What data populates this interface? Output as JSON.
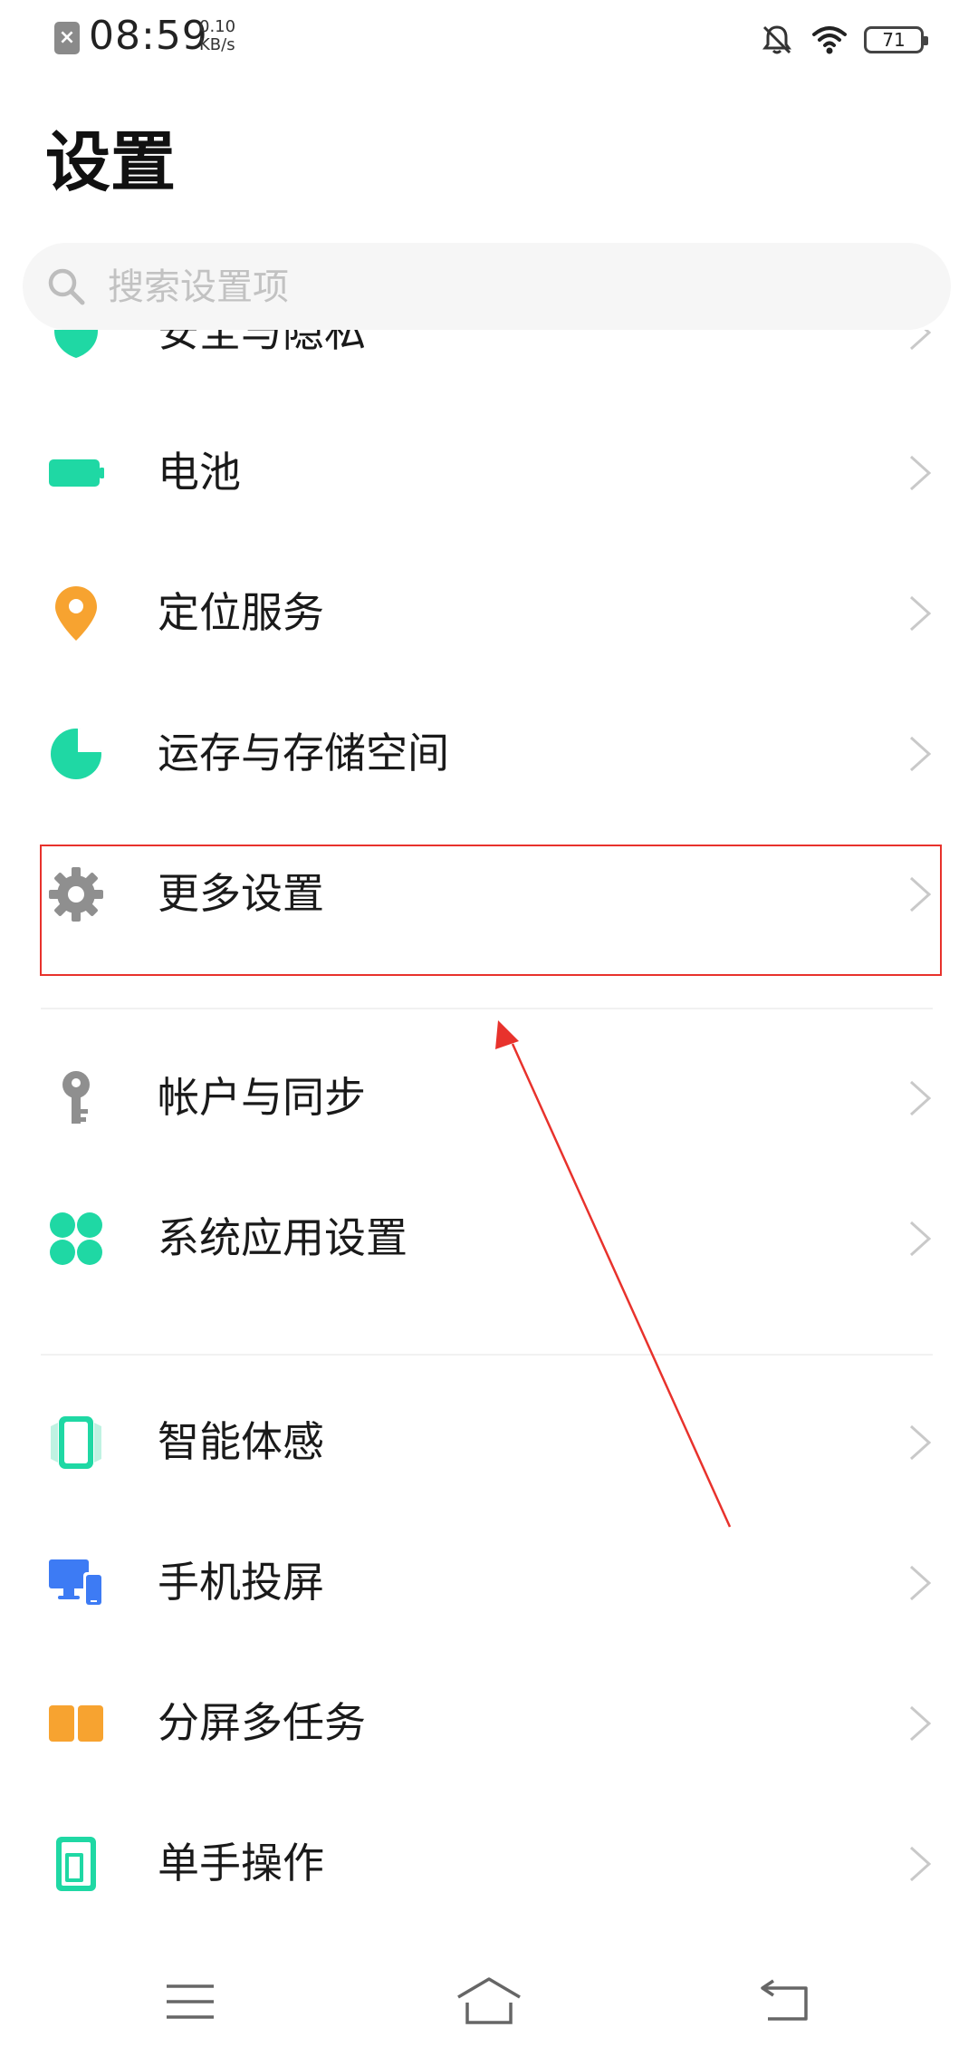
{
  "status_bar": {
    "sim_icon": "sim-error-icon",
    "time": "08:59",
    "net_speed_value": "0.10",
    "net_speed_unit": "KB/s",
    "battery_level": "71"
  },
  "header": {
    "title": "设置"
  },
  "search": {
    "placeholder": "搜索设置项",
    "value": ""
  },
  "settings_list": {
    "group_one": [
      {
        "label": "安全与隐私",
        "icon": "shield-icon",
        "color": "#1fd8a4"
      },
      {
        "label": "电池",
        "icon": "battery-icon",
        "color": "#1fd8a4"
      },
      {
        "label": "定位服务",
        "icon": "location-pin-icon",
        "color": "#f7a330"
      },
      {
        "label": "运存与存储空间",
        "icon": "pie-chart-icon",
        "color": "#1fd8a4"
      },
      {
        "label": "更多设置",
        "icon": "gear-icon",
        "color": "#8f8f8f"
      }
    ],
    "group_two": [
      {
        "label": "帐户与同步",
        "icon": "key-icon",
        "color": "#8f8f8f"
      },
      {
        "label": "系统应用设置",
        "icon": "apps-grid-icon",
        "color": "#1fd8a4"
      }
    ],
    "group_three": [
      {
        "label": "智能体感",
        "icon": "motion-phone-icon",
        "color": "#1fd8a4"
      },
      {
        "label": "手机投屏",
        "icon": "screen-cast-icon",
        "color": "#3d7bf4"
      },
      {
        "label": "分屏多任务",
        "icon": "split-screen-icon",
        "color": "#f7a330"
      },
      {
        "label": "单手操作",
        "icon": "one-hand-icon",
        "color": "#1fd8a4"
      }
    ]
  },
  "annotation": {
    "color": "#e8322c"
  },
  "nav_bar": {
    "menu_icon": "menu-icon",
    "home_icon": "home-icon",
    "back_icon": "back-icon"
  }
}
